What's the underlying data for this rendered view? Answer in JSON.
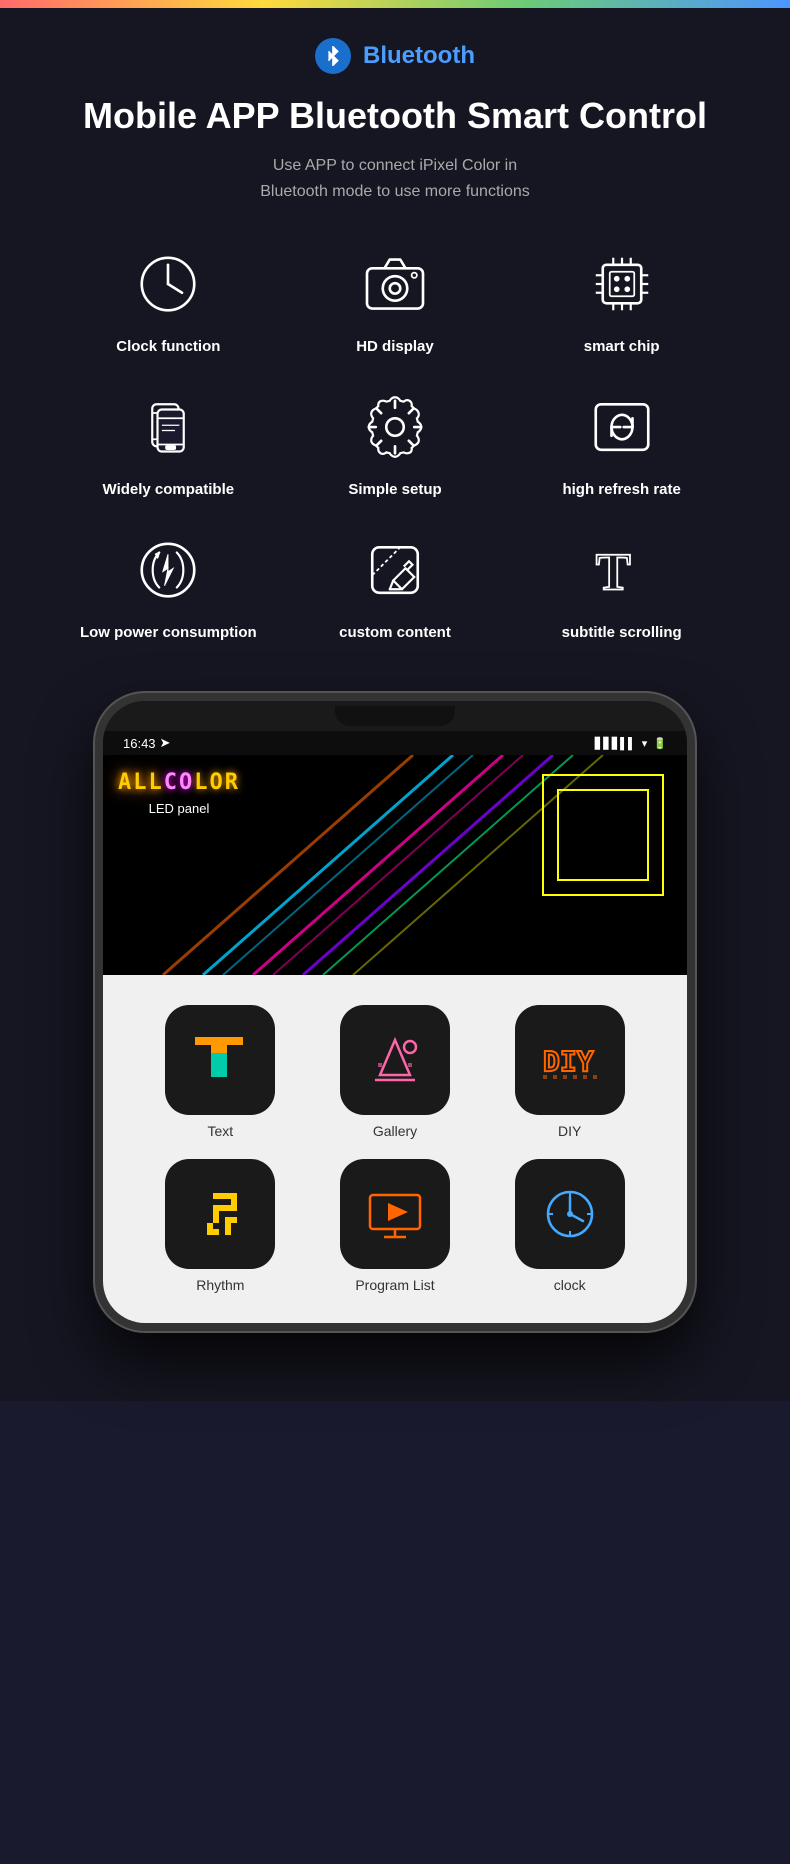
{
  "top_banner": {
    "colors": [
      "#ff6b6b",
      "#ffd93d",
      "#6bcb77",
      "#4d96ff"
    ]
  },
  "bluetooth": {
    "icon_label": "bluetooth-icon",
    "label": "Bluetooth"
  },
  "hero": {
    "title": "Mobile APP Bluetooth Smart Control",
    "subtitle": "Use APP to connect iPixel Color in\nBluetooth mode to use more functions"
  },
  "features": [
    {
      "id": "clock-function",
      "label": "Clock function",
      "icon": "clock"
    },
    {
      "id": "hd-display",
      "label": "HD display",
      "icon": "camera"
    },
    {
      "id": "smart-chip",
      "label": "smart chip",
      "icon": "chip"
    },
    {
      "id": "widely-compatible",
      "label": "Widely compatible",
      "icon": "phone-layers"
    },
    {
      "id": "simple-setup",
      "label": "Simple setup",
      "icon": "gear"
    },
    {
      "id": "high-refresh-rate",
      "label": "high refresh rate",
      "icon": "refresh"
    },
    {
      "id": "low-power",
      "label": "Low power consumption",
      "icon": "lightning"
    },
    {
      "id": "custom-content",
      "label": "custom content",
      "icon": "edit"
    },
    {
      "id": "subtitle-scrolling",
      "label": "subtitle scrolling",
      "icon": "text-t"
    }
  ],
  "phone": {
    "time": "16:43",
    "led_panel_label": "LED panel",
    "led_text": "ALLCOLOR",
    "apps": [
      {
        "id": "text",
        "label": "Text",
        "emoji": "🔤"
      },
      {
        "id": "gallery",
        "label": "Gallery",
        "emoji": "🏔"
      },
      {
        "id": "diy",
        "label": "DIY",
        "emoji": "🔧"
      },
      {
        "id": "rhythm",
        "label": "Rhythm",
        "emoji": "🎵"
      },
      {
        "id": "program-list",
        "label": "Program List",
        "emoji": "📺"
      },
      {
        "id": "clock",
        "label": "clock",
        "emoji": "🕐"
      }
    ]
  }
}
